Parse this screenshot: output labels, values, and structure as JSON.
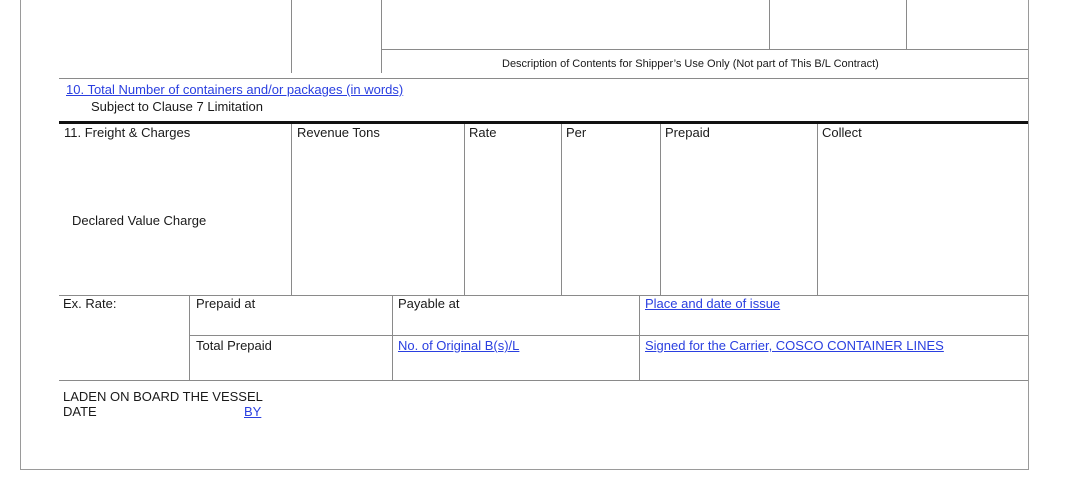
{
  "top": {
    "description_note": "Description of Contents for Shipper’s Use Only (Not part of This B/L Contract)"
  },
  "section10": {
    "title": "10. Total Number of containers and/or packages (in words)",
    "subtitle": "Subject to Clause 7 Limitation"
  },
  "freight": {
    "headers": [
      "11. Freight & Charges",
      "Revenue Tons",
      "Rate",
      "Per",
      "Prepaid",
      "Collect"
    ],
    "declared_value_label": "Declared Value Charge"
  },
  "payment": {
    "ex_rate": "Ex. Rate:",
    "prepaid_at": "Prepaid at",
    "payable_at": "Payable at",
    "place_date_issue": "Place and date of issue",
    "total_prepaid": "Total Prepaid",
    "no_original": "No. of Original B(s)/L",
    "signed_for": "Signed for the Carrier, COSCO CONTAINER LINES"
  },
  "laden": {
    "title": "LADEN ON BOARD THE VESSEL",
    "date_label": "DATE",
    "by_label": "BY"
  },
  "colors": {
    "link": "#2a3fe0",
    "rule": "#8a8a8a",
    "heavy_rule": "#111111"
  }
}
